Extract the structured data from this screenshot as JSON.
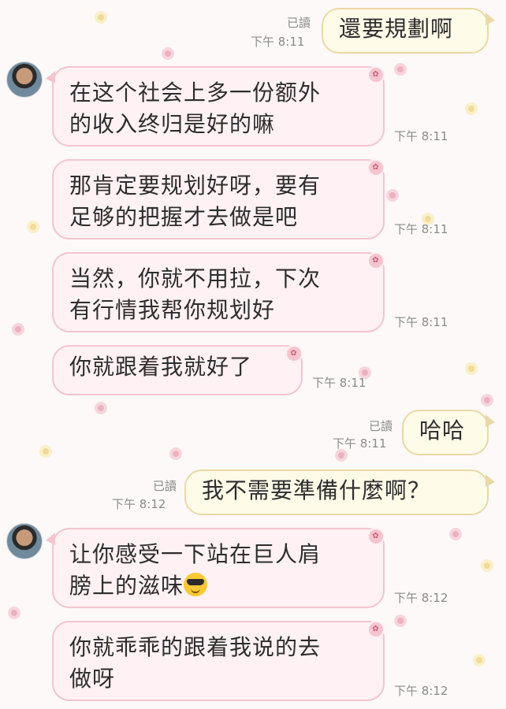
{
  "messages": [
    {
      "side": "out",
      "text": "還要規劃啊",
      "read": "已讀",
      "time": "下午 8:11"
    },
    {
      "side": "in",
      "text": "在这个社会上多一份额外的收入终归是好的嘛",
      "time": "下午 8:11"
    },
    {
      "side": "in",
      "text": "那肯定要规划好呀，要有足够的把握才去做是吧",
      "time": "下午 8:11"
    },
    {
      "side": "in",
      "text": "当然，你就不用拉，下次有行情我帮你规划好",
      "time": "下午 8:11"
    },
    {
      "side": "in",
      "text": "你就跟着我就好了",
      "time": "下午 8:11"
    },
    {
      "side": "out",
      "text": "哈哈",
      "read": "已讀",
      "time": "下午 8:11"
    },
    {
      "side": "out",
      "text": "我不需要準備什麼啊？",
      "read": "已讀",
      "time": "下午 8:12"
    },
    {
      "side": "in",
      "text": "让你感受一下站在巨人肩膀上的滋味",
      "emoji": "smiling-face-with-sunglasses-icon",
      "time": "下午 8:12"
    },
    {
      "side": "in",
      "text": "你就乖乖的跟着我说的去做呀",
      "time": "下午 8:12"
    }
  ],
  "lines": {
    "m1": [
      "在这个社会上多一份额外",
      "的收入终归是好的嘛"
    ],
    "m2": [
      "那肯定要规划好呀，要有",
      "足够的把握才去做是吧"
    ],
    "m3": [
      "当然，你就不用拉，下次",
      "有行情我帮你规划好"
    ],
    "m7": [
      "让你感受一下站在巨人肩",
      "膀上的滋味"
    ],
    "m8": [
      "你就乖乖的跟着我说的去",
      "做呀"
    ]
  },
  "colors": {
    "incoming_bubble": "#fff1f4",
    "incoming_border": "#f2c5cf",
    "outgoing_bubble": "#fffbe9",
    "outgoing_border": "#ead9a6"
  }
}
